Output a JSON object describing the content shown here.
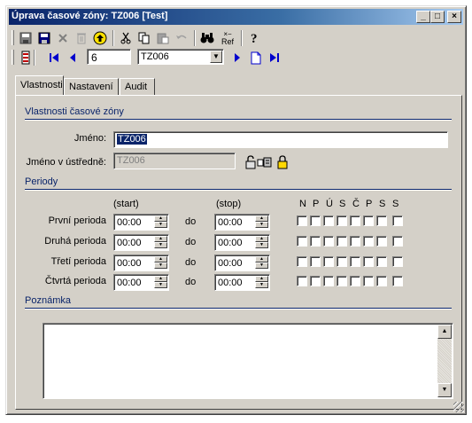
{
  "window": {
    "title": "Úprava časové zóny: TZ006 [Test]",
    "controls": {
      "minimize": "_",
      "maximize": "□",
      "close": "×"
    }
  },
  "toolbar1": {
    "icons": [
      "save-icon",
      "save-close-icon",
      "delete-x-icon",
      "trash-icon",
      "up-arrow-circle-icon",
      "cut-icon",
      "copy-icon",
      "paste-icon",
      "undo-icon",
      "find-binoculars-icon",
      "refresh-ref-icon",
      "help-icon"
    ],
    "ref_label": "Ref"
  },
  "toolbar2": {
    "record_number": "6",
    "record_selector": "TZ006",
    "icons": [
      "first-record-icon",
      "prev-record-icon",
      "next-record-icon",
      "new-record-icon",
      "last-record-icon"
    ]
  },
  "tabs": [
    {
      "label": "Vlastnosti",
      "active": true
    },
    {
      "label": "Nastavení",
      "active": false
    },
    {
      "label": "Audit",
      "active": false
    }
  ],
  "properties": {
    "section_title": "Vlastnosti časové zóny",
    "name_label": "Jméno:",
    "name_value": "TZ006",
    "central_name_label": "Jméno v ústředně:",
    "central_name_value": "TZ006"
  },
  "periods": {
    "section_title": "Periody",
    "start_header": "(start)",
    "stop_header": "(stop)",
    "day_headers": [
      "N",
      "P",
      "Ú",
      "S",
      "Č",
      "P",
      "S",
      "S"
    ],
    "separator": "do",
    "rows": [
      {
        "label": "První perioda",
        "start": "00:00",
        "stop": "00:00"
      },
      {
        "label": "Druhá perioda",
        "start": "00:00",
        "stop": "00:00"
      },
      {
        "label": "Třetí perioda",
        "start": "00:00",
        "stop": "00:00"
      },
      {
        "label": "Čtvrtá perioda",
        "start": "00:00",
        "stop": "00:00"
      }
    ]
  },
  "note": {
    "section_title": "Poznámka",
    "value": ""
  },
  "colors": {
    "face": "#d4d0c8",
    "title_bar": "#0a246a",
    "section_text": "#0a246a",
    "nav_blue": "#0000cc"
  }
}
